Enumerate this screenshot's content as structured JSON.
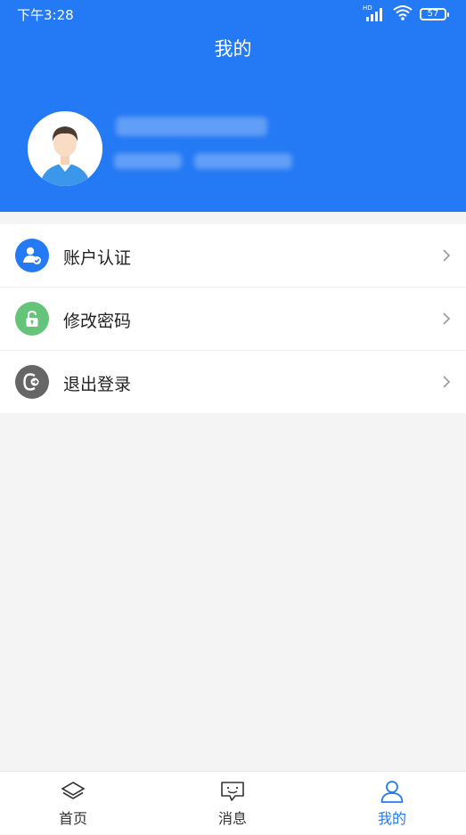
{
  "status_bar": {
    "time": "下午3:28",
    "network_label": "HD",
    "battery": "57"
  },
  "header": {
    "title": "我的",
    "background_color": "#2479f4"
  },
  "menu": {
    "items": [
      {
        "label": "账户认证",
        "icon": "user-verified-icon",
        "color": "#2479f4"
      },
      {
        "label": "修改密码",
        "icon": "lock-icon",
        "color": "#66c47a"
      },
      {
        "label": "退出登录",
        "icon": "logout-icon",
        "color": "#666666"
      }
    ]
  },
  "tabbar": {
    "tabs": [
      {
        "label": "首页",
        "icon": "home-layers-icon",
        "active": false
      },
      {
        "label": "消息",
        "icon": "message-icon",
        "active": false
      },
      {
        "label": "我的",
        "icon": "user-icon",
        "active": true
      }
    ],
    "active_color": "#2479f4"
  }
}
